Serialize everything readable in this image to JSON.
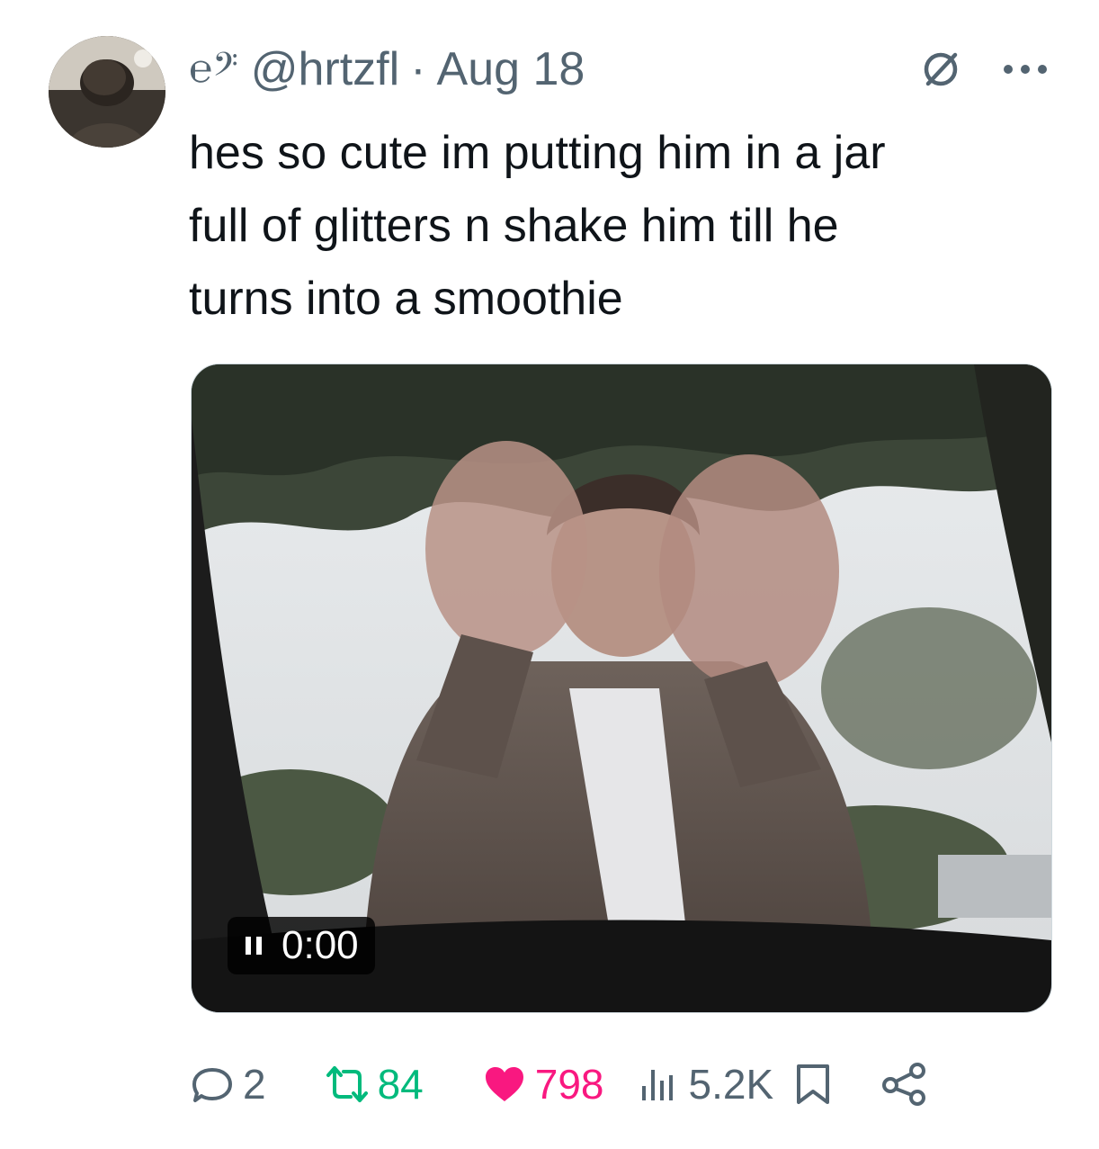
{
  "post": {
    "author_handle": "@hrtzfl",
    "separator": "·",
    "date": "Aug 18",
    "badge_glyph": "℮𝄢",
    "text": "hes so cute im putting him in a jar\nfull of glitters n shake him till he\nturns into a smoothie"
  },
  "media": {
    "type": "video",
    "time": "0:00",
    "state": "paused",
    "pause_icon": "pause-icon"
  },
  "actions": {
    "replies": "2",
    "reposts": "84",
    "likes": "798",
    "views": "5.2K",
    "icons": [
      "reply-icon",
      "repost-icon",
      "like-icon",
      "views-icon",
      "bookmark-icon",
      "share-icon"
    ]
  },
  "colors": {
    "text": "#0f1419",
    "secondary": "#536471",
    "repost": "#00ba7c",
    "like": "#f91880"
  }
}
